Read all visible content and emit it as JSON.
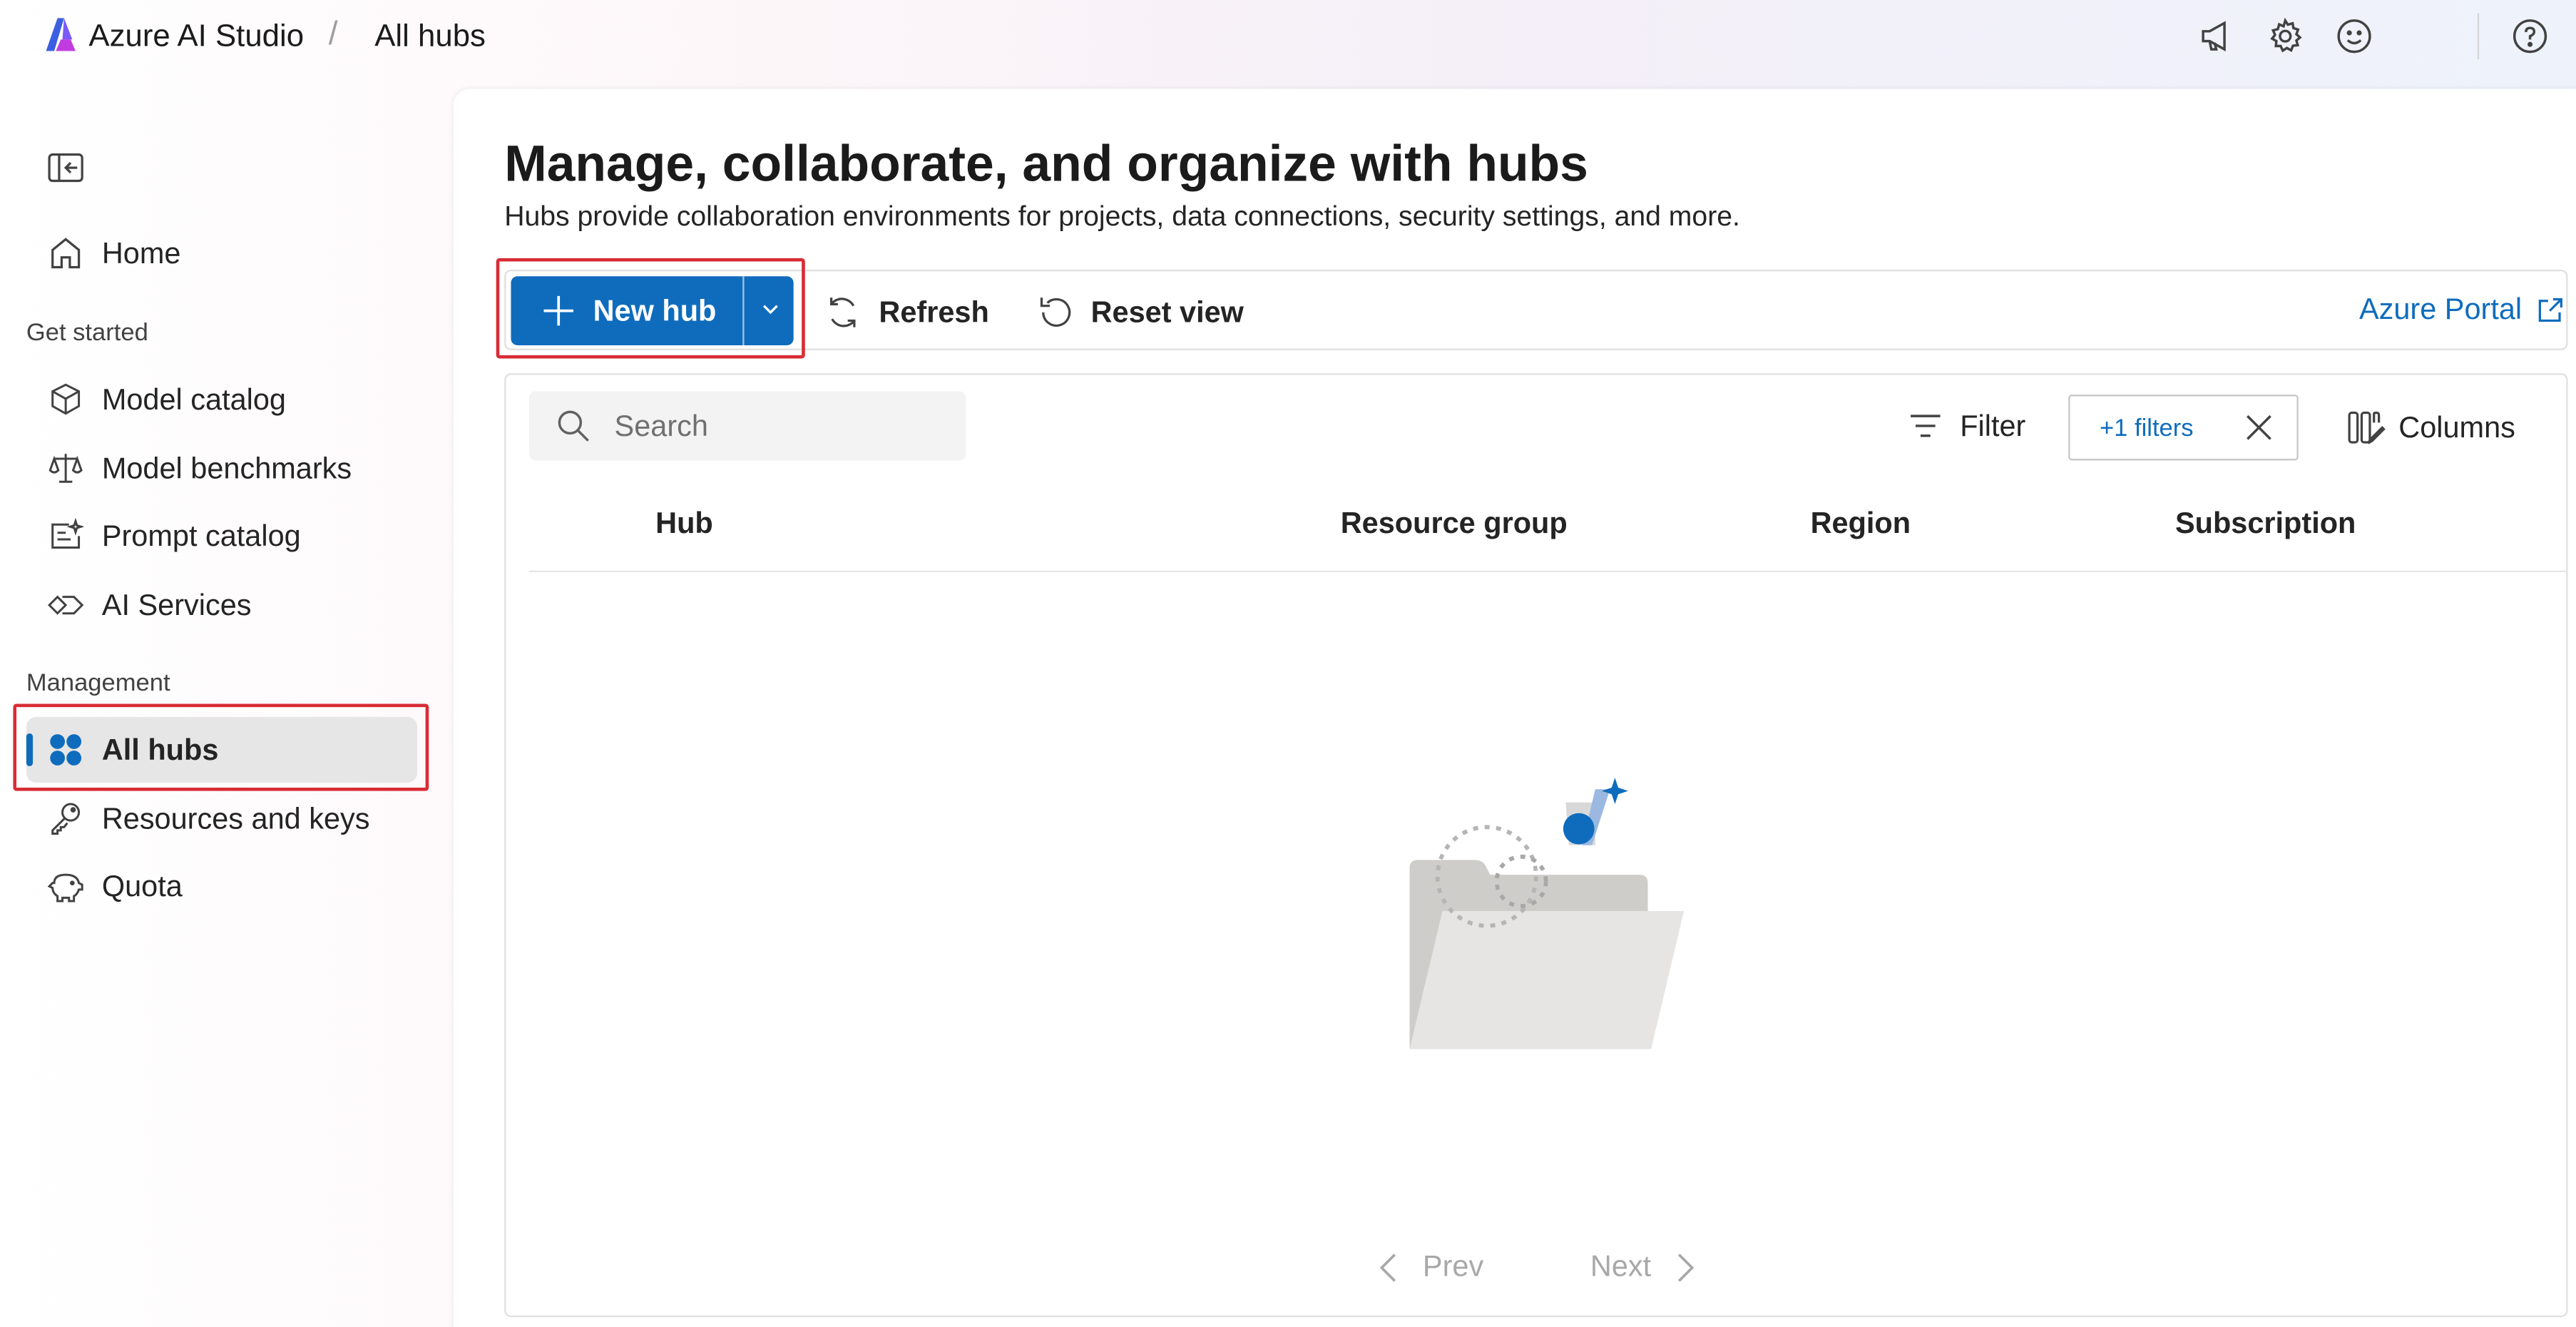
{
  "header": {
    "app_title": "Azure AI Studio",
    "breadcrumb_separator": "/",
    "breadcrumb_current": "All hubs",
    "icons": [
      "megaphone-icon",
      "gear-icon",
      "smiley-icon",
      "help-icon"
    ]
  },
  "sidebar": {
    "home": "Home",
    "section_get_started": "Get started",
    "get_started_items": [
      "Model catalog",
      "Model benchmarks",
      "Prompt catalog",
      "AI Services"
    ],
    "section_management": "Management",
    "management_items": [
      "All hubs",
      "Resources and keys",
      "Quota"
    ],
    "active_item": "All hubs"
  },
  "main": {
    "title": "Manage, collaborate, and organize with hubs",
    "subtitle": "Hubs provide collaboration environments for projects, data connections, security settings, and more.",
    "toolbar": {
      "new_hub": "New hub",
      "refresh": "Refresh",
      "reset_view": "Reset view",
      "azure_portal": "Azure Portal"
    },
    "grid": {
      "search_placeholder": "Search",
      "filter": "Filter",
      "filter_chip": "+1 filters",
      "columns": "Columns",
      "headers": [
        "Hub",
        "Resource group",
        "Region",
        "Subscription"
      ],
      "prev": "Prev",
      "next": "Next"
    }
  },
  "colors": {
    "accent": "#0f6cbd",
    "highlight_border": "#d82c35"
  }
}
